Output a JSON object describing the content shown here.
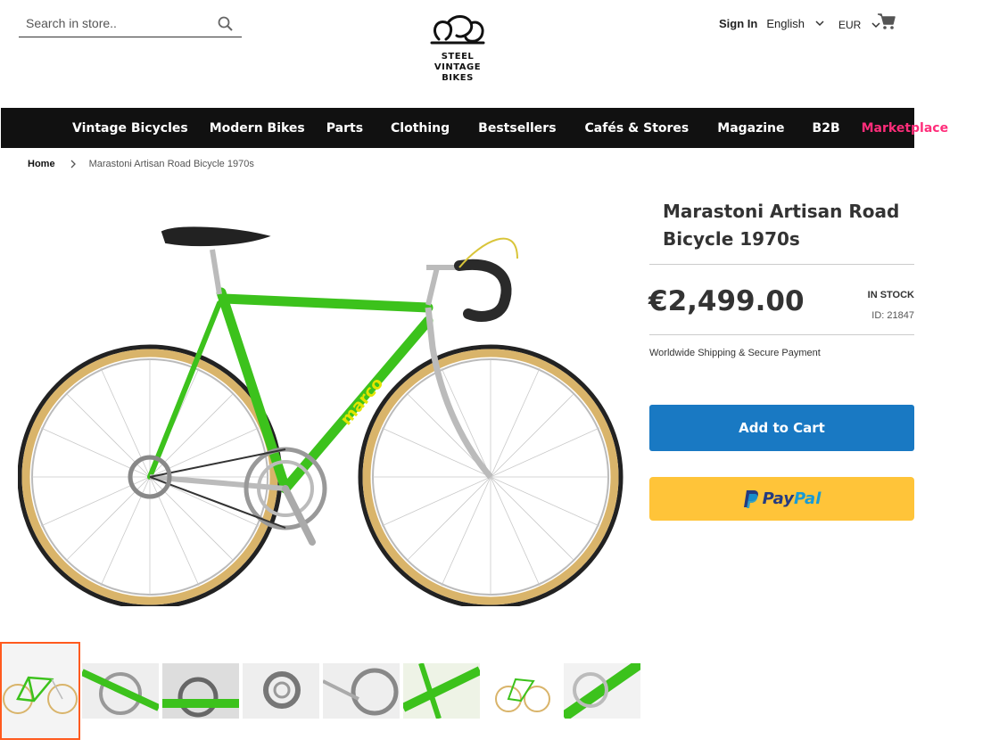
{
  "header": {
    "search_placeholder": "Search in store..",
    "signin_label": "Sign In",
    "language": "English",
    "currency": "EUR",
    "logo_text": [
      "STEEL",
      "VINTAGE",
      "BIKES"
    ]
  },
  "nav": {
    "items": [
      "Vintage Bicycles",
      "Modern Bikes",
      "Parts",
      "Clothing",
      "Bestsellers",
      "Cafés & Stores",
      "Magazine",
      "B2B",
      "Marketplace"
    ]
  },
  "breadcrumb": {
    "home": "Home",
    "current": "Marastoni Artisan Road Bicycle 1970s"
  },
  "product": {
    "title": "Marastoni Artisan Road Bicycle 1970s",
    "price": "€2,499.00",
    "stock": "IN STOCK",
    "sku": "ID: 21847",
    "shipping": "Worldwide Shipping & Secure Payment",
    "add_to_cart": "Add to Cart",
    "paypal_a": "Pay",
    "paypal_b": "Pal"
  },
  "icons": {
    "search": "search-icon",
    "cart": "cart-icon",
    "chevron": "chevron-down-icon"
  },
  "colors": {
    "nav_bg": "#111111",
    "marketplace": "#ff2d7a",
    "add_to_cart": "#1979c3",
    "paypal_bg": "#ffc439",
    "frame_green": "#3cc21c",
    "thumb_active": "#ff5a1e"
  }
}
